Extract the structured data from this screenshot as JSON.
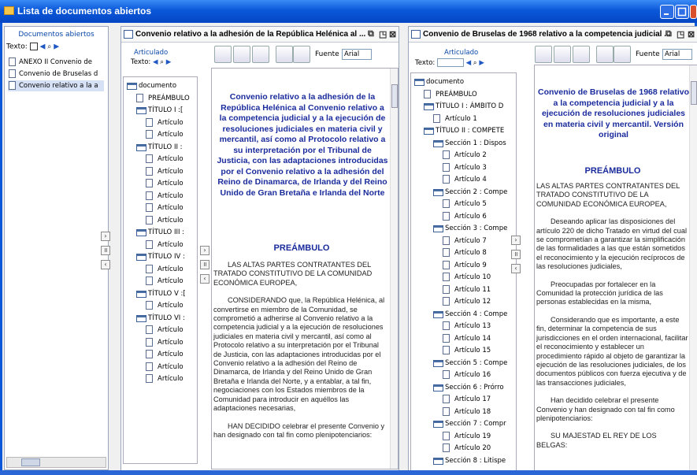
{
  "window": {
    "title": "Lista de documentos abiertos"
  },
  "sidebar": {
    "header": "Documentos abiertos",
    "texto": "Texto:",
    "items": [
      "ANEXO II Convenio de",
      "Convenio de Bruselas d",
      "Convenio relativo a la a"
    ]
  },
  "panel1": {
    "title": "Convenio relativo a la adhesión de la República Helénica al ...",
    "articulado": "Articulado",
    "texto": "Texto:",
    "fuente_label": "Fuente",
    "fuente_value": "Arial",
    "tree": [
      "documento",
      "PREÁMBULO",
      "TÍTULO I :[",
      "Artículo",
      "Artículo",
      "TÍTULO II :",
      "Artículo",
      "Artículo",
      "Artículo",
      "Artículo",
      "Artículo",
      "Artículo",
      "TÍTULO III :",
      "Artículo",
      "TÍTULO IV :",
      "Artículo",
      "Artículo",
      "TÍTULO V :[",
      "Artículo",
      "TÍTULO VI :",
      "Artículo",
      "Artículo",
      "Artículo",
      "Artículo",
      "Artículo"
    ],
    "doc_title": "Convenio relativo a la adhesión de la República Helénica al Convenio relativo a la competencia judicial y a la ejecución de resoluciones judiciales en materia civil y mercantil, así como al Protocolo relativo a su interpretación por el Tribunal de Justicia, con las adaptaciones introducidas por el Convenio relativo a la adhesión del Reino de Dinamarca, de Irlanda y del Reino Unido de Gran Bretaña e Irlanda del Norte",
    "preambulo": "PREÁMBULO",
    "paras": [
      "LAS ALTAS PARTES CONTRATANTES DEL TRATADO CONSTITUTIVO DE LA COMUNIDAD ECONÓMICA EUROPEA,",
      "CONSIDERANDO que, la República Helénica, al convertirse en miembro de la Comunidad, se comprometió a adherirse al Convenio relativo a la competencia judicial y a la ejecución de resoluciones judiciales en materia civil y mercantil, así como al Protocolo relativo a su interpretación por el Tribunal de Justicia, con las adaptaciones introducidas por el Convenio relativo a la adhesión del Reino de Dinamarca, de Irlanda y del Reino Unido de Gran Bretaña e Irlanda del Norte, y a entablar, a tal fin, negociaciones con los Estados miembros de la Comunidad para introducir en aquéllos las adaptaciones necesarias,",
      "HAN DECIDIDO celebrar el presente Convenio y han designado con tal fin como plenipotenciarios:"
    ]
  },
  "panel2": {
    "title": "Convenio de Bruselas de 1968 relativo a la competencia judicial ...",
    "articulado": "Articulado",
    "texto": "Texto:",
    "fuente_label": "Fuente",
    "fuente_value": "Arial",
    "tree": [
      "documento",
      "PREÁMBULO",
      "TÍTULO I : ÁMBITO D",
      "Artículo 1",
      "TÍTULO II : COMPETE",
      "Sección 1 : Dispos",
      "Artículo 2",
      "Artículo 3",
      "Artículo 4",
      "Sección 2 : Compe",
      "Artículo 5",
      "Artículo 6",
      "Sección 3 : Compe",
      "Artículo 7",
      "Artículo 8",
      "Artículo 9",
      "Artículo 10",
      "Artículo 11",
      "Artículo 12",
      "Sección 4 : Compe",
      "Artículo 13",
      "Artículo 14",
      "Artículo 15",
      "Sección 5 : Compe",
      "Artículo 16",
      "Sección 6 : Prórro",
      "Artículo 17",
      "Artículo 18",
      "Sección 7 : Compr",
      "Artículo 19",
      "Artículo 20",
      "Sección 8 : Litispe"
    ],
    "doc_title": "Convenio de Bruselas de 1968 relativo a la competencia judicial y a la ejecución de resoluciones judiciales en materia civil y mercantil. Versión original",
    "preambulo": "PREÁMBULO",
    "paras": [
      "LAS ALTAS PARTES CONTRATANTES DEL TRATADO CONSTITUTIVO DE LA COMUNIDAD ECONÓMICA EUROPEA,",
      "Deseando aplicar las disposiciones del artículo 220 de dicho Tratado en virtud del cual se comprometían a garantizar la simplificación de las formalidades a las que están sometidos el reconocimiento y la ejecución recíprocos de las resoluciones judiciales,",
      "Preocupadas por fortalecer en la Comunidad la protección jurídica de las personas establecidas en la misma,",
      "Considerando que es importante, a este fin, determinar la competencia de sus jurisdicciones en el orden internacional, facilitar el reconocimiento y establecer un procedimiento rápido al objeto de garantizar la ejecución de las resoluciones judiciales, de los documentos públicos con fuerza ejecutiva y de las transacciones judiciales,",
      "Han decidido celebrar el presente Convenio y han designado con tal fin como plenipotenciarios:",
      "SU MAJESTAD EL REY DE LOS BELGAS:"
    ]
  }
}
